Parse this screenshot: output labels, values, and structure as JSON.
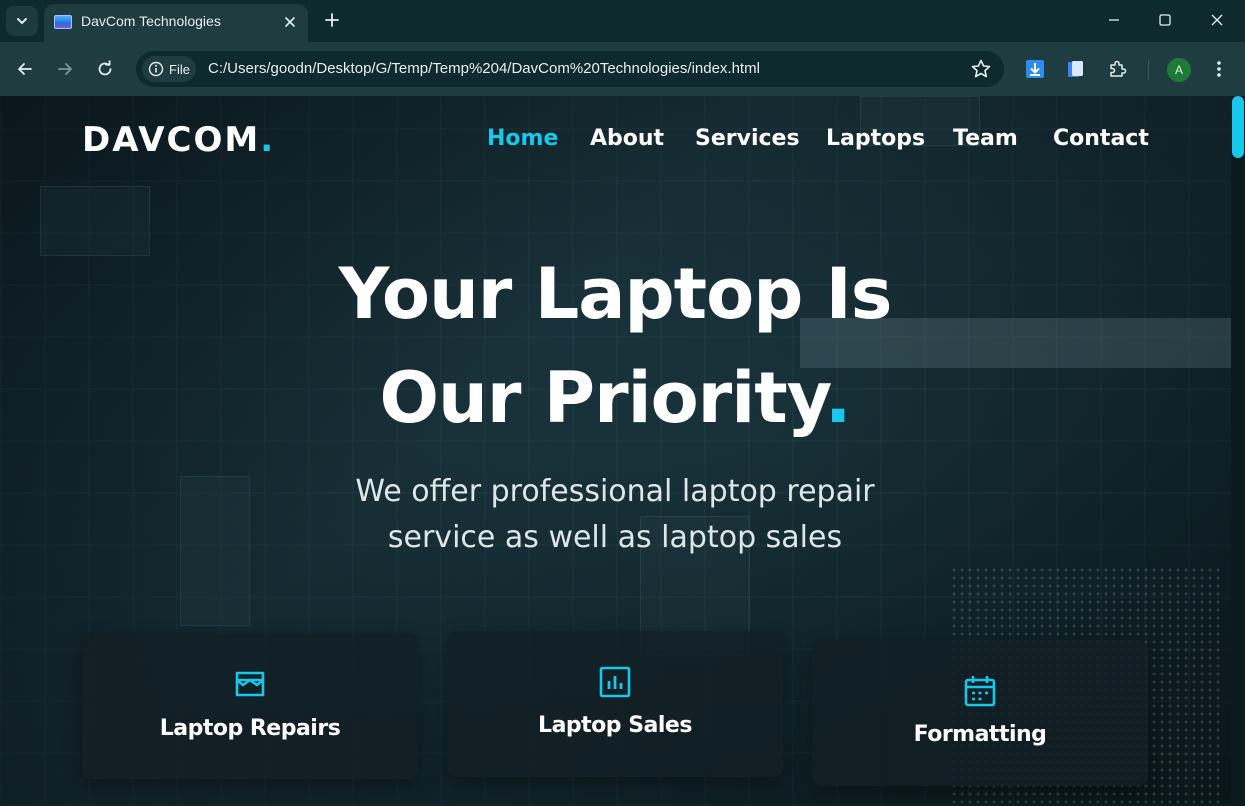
{
  "browser": {
    "tab_title": "DavCom Technologies",
    "site_chip_label": "File",
    "url": "C:/Users/goodn/Desktop/G/Temp/Temp%204/DavCom%20Technologies/index.html",
    "profile_initial": "A",
    "accent_color": "#1f3c40"
  },
  "site": {
    "logo_text": "DAVCOM",
    "logo_dot": ".",
    "accent_color": "#19c7ea",
    "nav": [
      {
        "label": "Home",
        "active": true
      },
      {
        "label": "About",
        "active": false
      },
      {
        "label": "Services",
        "active": false
      },
      {
        "label": "Laptops",
        "active": false
      },
      {
        "label": "Team",
        "active": false
      },
      {
        "label": "Contact",
        "active": false
      }
    ],
    "hero": {
      "headline_line1": "Your Laptop Is",
      "headline_line2": "Our Priority",
      "headline_dot": ".",
      "subhead_line1": "We offer professional laptop repair",
      "subhead_line2": "service as well as laptop sales"
    },
    "cards": [
      {
        "label": "Laptop Repairs",
        "icon": "store-icon"
      },
      {
        "label": "Laptop Sales",
        "icon": "bar-chart-icon"
      },
      {
        "label": "Formatting",
        "icon": "calendar-icon"
      }
    ]
  }
}
